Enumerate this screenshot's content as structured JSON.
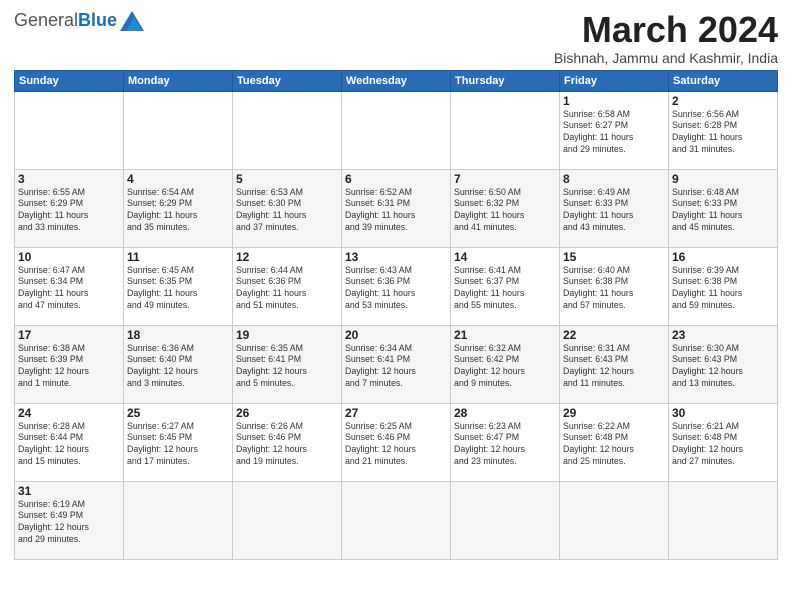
{
  "header": {
    "logo_general": "General",
    "logo_blue": "Blue",
    "month_title": "March 2024",
    "subtitle": "Bishnah, Jammu and Kashmir, India"
  },
  "weekdays": [
    "Sunday",
    "Monday",
    "Tuesday",
    "Wednesday",
    "Thursday",
    "Friday",
    "Saturday"
  ],
  "weeks": [
    [
      {
        "day": "",
        "info": ""
      },
      {
        "day": "",
        "info": ""
      },
      {
        "day": "",
        "info": ""
      },
      {
        "day": "",
        "info": ""
      },
      {
        "day": "",
        "info": ""
      },
      {
        "day": "1",
        "info": "Sunrise: 6:58 AM\nSunset: 6:27 PM\nDaylight: 11 hours\nand 29 minutes."
      },
      {
        "day": "2",
        "info": "Sunrise: 6:56 AM\nSunset: 6:28 PM\nDaylight: 11 hours\nand 31 minutes."
      }
    ],
    [
      {
        "day": "3",
        "info": "Sunrise: 6:55 AM\nSunset: 6:29 PM\nDaylight: 11 hours\nand 33 minutes."
      },
      {
        "day": "4",
        "info": "Sunrise: 6:54 AM\nSunset: 6:29 PM\nDaylight: 11 hours\nand 35 minutes."
      },
      {
        "day": "5",
        "info": "Sunrise: 6:53 AM\nSunset: 6:30 PM\nDaylight: 11 hours\nand 37 minutes."
      },
      {
        "day": "6",
        "info": "Sunrise: 6:52 AM\nSunset: 6:31 PM\nDaylight: 11 hours\nand 39 minutes."
      },
      {
        "day": "7",
        "info": "Sunrise: 6:50 AM\nSunset: 6:32 PM\nDaylight: 11 hours\nand 41 minutes."
      },
      {
        "day": "8",
        "info": "Sunrise: 6:49 AM\nSunset: 6:33 PM\nDaylight: 11 hours\nand 43 minutes."
      },
      {
        "day": "9",
        "info": "Sunrise: 6:48 AM\nSunset: 6:33 PM\nDaylight: 11 hours\nand 45 minutes."
      }
    ],
    [
      {
        "day": "10",
        "info": "Sunrise: 6:47 AM\nSunset: 6:34 PM\nDaylight: 11 hours\nand 47 minutes."
      },
      {
        "day": "11",
        "info": "Sunrise: 6:45 AM\nSunset: 6:35 PM\nDaylight: 11 hours\nand 49 minutes."
      },
      {
        "day": "12",
        "info": "Sunrise: 6:44 AM\nSunset: 6:36 PM\nDaylight: 11 hours\nand 51 minutes."
      },
      {
        "day": "13",
        "info": "Sunrise: 6:43 AM\nSunset: 6:36 PM\nDaylight: 11 hours\nand 53 minutes."
      },
      {
        "day": "14",
        "info": "Sunrise: 6:41 AM\nSunset: 6:37 PM\nDaylight: 11 hours\nand 55 minutes."
      },
      {
        "day": "15",
        "info": "Sunrise: 6:40 AM\nSunset: 6:38 PM\nDaylight: 11 hours\nand 57 minutes."
      },
      {
        "day": "16",
        "info": "Sunrise: 6:39 AM\nSunset: 6:38 PM\nDaylight: 11 hours\nand 59 minutes."
      }
    ],
    [
      {
        "day": "17",
        "info": "Sunrise: 6:38 AM\nSunset: 6:39 PM\nDaylight: 12 hours\nand 1 minute."
      },
      {
        "day": "18",
        "info": "Sunrise: 6:36 AM\nSunset: 6:40 PM\nDaylight: 12 hours\nand 3 minutes."
      },
      {
        "day": "19",
        "info": "Sunrise: 6:35 AM\nSunset: 6:41 PM\nDaylight: 12 hours\nand 5 minutes."
      },
      {
        "day": "20",
        "info": "Sunrise: 6:34 AM\nSunset: 6:41 PM\nDaylight: 12 hours\nand 7 minutes."
      },
      {
        "day": "21",
        "info": "Sunrise: 6:32 AM\nSunset: 6:42 PM\nDaylight: 12 hours\nand 9 minutes."
      },
      {
        "day": "22",
        "info": "Sunrise: 6:31 AM\nSunset: 6:43 PM\nDaylight: 12 hours\nand 11 minutes."
      },
      {
        "day": "23",
        "info": "Sunrise: 6:30 AM\nSunset: 6:43 PM\nDaylight: 12 hours\nand 13 minutes."
      }
    ],
    [
      {
        "day": "24",
        "info": "Sunrise: 6:28 AM\nSunset: 6:44 PM\nDaylight: 12 hours\nand 15 minutes."
      },
      {
        "day": "25",
        "info": "Sunrise: 6:27 AM\nSunset: 6:45 PM\nDaylight: 12 hours\nand 17 minutes."
      },
      {
        "day": "26",
        "info": "Sunrise: 6:26 AM\nSunset: 6:46 PM\nDaylight: 12 hours\nand 19 minutes."
      },
      {
        "day": "27",
        "info": "Sunrise: 6:25 AM\nSunset: 6:46 PM\nDaylight: 12 hours\nand 21 minutes."
      },
      {
        "day": "28",
        "info": "Sunrise: 6:23 AM\nSunset: 6:47 PM\nDaylight: 12 hours\nand 23 minutes."
      },
      {
        "day": "29",
        "info": "Sunrise: 6:22 AM\nSunset: 6:48 PM\nDaylight: 12 hours\nand 25 minutes."
      },
      {
        "day": "30",
        "info": "Sunrise: 6:21 AM\nSunset: 6:48 PM\nDaylight: 12 hours\nand 27 minutes."
      }
    ],
    [
      {
        "day": "31",
        "info": "Sunrise: 6:19 AM\nSunset: 6:49 PM\nDaylight: 12 hours\nand 29 minutes."
      },
      {
        "day": "",
        "info": ""
      },
      {
        "day": "",
        "info": ""
      },
      {
        "day": "",
        "info": ""
      },
      {
        "day": "",
        "info": ""
      },
      {
        "day": "",
        "info": ""
      },
      {
        "day": "",
        "info": ""
      }
    ]
  ]
}
